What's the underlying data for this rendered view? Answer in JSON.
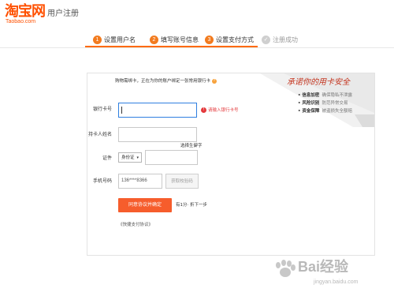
{
  "header": {
    "logo_cn": "淘宝网",
    "logo_en": "Taobao.com",
    "title": "用户注册"
  },
  "steps": [
    {
      "num": "1",
      "label": "设置用户名"
    },
    {
      "num": "2",
      "label": "填写账号信息"
    },
    {
      "num": "3",
      "label": "设置支付方式"
    },
    {
      "num": "✓",
      "label": "注册成功"
    }
  ],
  "form": {
    "note": "购物需绑卡，正在为你的账户绑定一张常用银行卡",
    "note_help": "?",
    "bank_card_label": "银行卡号",
    "bank_card_value": "",
    "bank_card_error_icon": "!",
    "bank_card_error": "请输入银行卡号",
    "holder_label": "持卡人姓名",
    "holder_value": "",
    "rare_char_link": "选择生僻字",
    "id_label": "证件",
    "id_type": "身份证",
    "id_type_caret": "▾",
    "id_value": "",
    "phone_label": "手机号码",
    "phone_value": "136****8366",
    "get_code_button": "获取校验码",
    "submit_button": "同意协议并确定",
    "prev_step": "有1分·  折下一步",
    "agreement": "《快捷支付协议》"
  },
  "promo": {
    "title": "承诺你的用卡安全",
    "items": [
      {
        "bold": "• 信息加密",
        "sub": "确保隐私不泄露"
      },
      {
        "bold": "• 风险识别",
        "sub": "防范异常交易"
      },
      {
        "bold": "• 资金保障",
        "sub": "被盗损失全额赔"
      }
    ]
  },
  "watermark": {
    "text": "Bai经验",
    "url": "jingyan.baidu.com"
  },
  "colors": {
    "brand": "#ff5000",
    "step_active": "#f27b1f",
    "submit": "#f65d2c",
    "error": "#e4393c",
    "focus_border": "#2f7fe0"
  }
}
